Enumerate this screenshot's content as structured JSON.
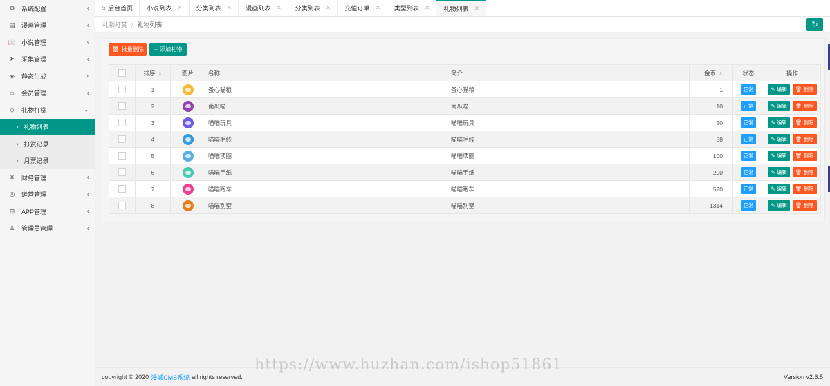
{
  "sidebar": {
    "items": [
      {
        "label": "系统配置",
        "icon": "settings-icon",
        "glyph": "⚙"
      },
      {
        "label": "漫画管理",
        "icon": "comic-icon",
        "glyph": "▤"
      },
      {
        "label": "小说管理",
        "icon": "book-icon",
        "glyph": "📖"
      },
      {
        "label": "采集管理",
        "icon": "send-icon",
        "glyph": "➤"
      },
      {
        "label": "静态生成",
        "icon": "layers-icon",
        "glyph": "◈"
      },
      {
        "label": "会员管理",
        "icon": "user-group-icon",
        "glyph": "☺"
      }
    ],
    "gift_menu": {
      "label": "礼物打赏",
      "icon": "gift-diamond-icon",
      "glyph": "◇"
    },
    "sub_items": [
      {
        "label": "礼物列表",
        "active": true
      },
      {
        "label": "打赏记录",
        "active": false
      },
      {
        "label": "月票记录",
        "active": false
      }
    ],
    "items_after": [
      {
        "label": "财务管理",
        "icon": "finance-icon",
        "glyph": "¥"
      },
      {
        "label": "运营管理",
        "icon": "globe-icon",
        "glyph": "◎"
      },
      {
        "label": "APP管理",
        "icon": "windows-icon",
        "glyph": "⊞"
      },
      {
        "label": "管理员管理",
        "icon": "admin-user-icon",
        "glyph": "♙"
      }
    ]
  },
  "tabs": {
    "home": "后台首页",
    "items": [
      "小说列表",
      "分类列表",
      "漫画列表",
      "分类列表",
      "充值订单",
      "类型列表",
      "礼物列表"
    ],
    "active_index": 6
  },
  "breadcrumb": {
    "parent": "礼物打赏",
    "current": "礼物列表"
  },
  "toolbar": {
    "batch_delete": "批量删除",
    "add_gift": "添加礼物"
  },
  "table": {
    "headers": {
      "sort": "排序",
      "image": "图片",
      "name": "名称",
      "intro": "简介",
      "coins": "金币",
      "status": "状态",
      "actions": "操作"
    },
    "edit_label": "编辑",
    "delete_label": "删除",
    "rows": [
      {
        "sort": "1",
        "name": "蚤心猫粮",
        "intro": "蚤心猫粮",
        "coins": "1",
        "status": "正常",
        "color": "#f6b93b"
      },
      {
        "sort": "2",
        "name": "南瓜喵",
        "intro": "南瓜喵",
        "coins": "10",
        "status": "正常",
        "color": "#8e44ad"
      },
      {
        "sort": "3",
        "name": "喵喵玩具",
        "intro": "喵喵玩具",
        "coins": "50",
        "status": "正常",
        "color": "#6c5ce7"
      },
      {
        "sort": "4",
        "name": "喵喵毛线",
        "intro": "喵喵毛线",
        "coins": "88",
        "status": "正常",
        "color": "#3498db"
      },
      {
        "sort": "5",
        "name": "喵喵项圈",
        "intro": "喵喵项圈",
        "coins": "100",
        "status": "正常",
        "color": "#5dade2"
      },
      {
        "sort": "6",
        "name": "喵喵手纸",
        "intro": "喵喵手纸",
        "coins": "200",
        "status": "正常",
        "color": "#48c9b0"
      },
      {
        "sort": "7",
        "name": "喵喵跑车",
        "intro": "喵喵跑车",
        "coins": "520",
        "status": "正常",
        "color": "#e84393"
      },
      {
        "sort": "8",
        "name": "喵喵别墅",
        "intro": "喵喵别墅",
        "coins": "1314",
        "status": "正常",
        "color": "#e67e22"
      }
    ]
  },
  "footer": {
    "prefix": "copyright © 2020",
    "brand": "漫城CMS系统",
    "suffix": "all rights reserved.",
    "version": "Version v2.6.5"
  },
  "watermark": "https://www.huzhan.com/ishop51861",
  "colors": {
    "accent": "#009688",
    "danger": "#ff5722",
    "info": "#1e9fff"
  }
}
